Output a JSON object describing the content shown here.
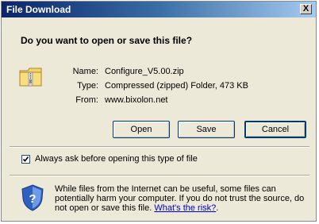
{
  "window": {
    "title": "File Download",
    "close_glyph": "X"
  },
  "prompt": {
    "question": "Do you want to open or save this file?"
  },
  "file_info": {
    "icon": "zip-folder-icon",
    "name_label": "Name:",
    "name_value": "Configure_V5.00.zip",
    "type_label": "Type:",
    "type_value": "Compressed (zipped) Folder, 473 KB",
    "from_label": "From:",
    "from_value": "www.bixolon.net"
  },
  "buttons": {
    "open": "Open",
    "save": "Save",
    "cancel": "Cancel"
  },
  "option": {
    "checked": true,
    "label": "Always ask before opening this type of file"
  },
  "warning": {
    "icon": "security-shield-icon",
    "text": "While files from the Internet can be useful, some files can potentially harm your computer. If you do not trust the source, do not open or save this file.",
    "link": "What's the risk?",
    "punctuation": "."
  }
}
